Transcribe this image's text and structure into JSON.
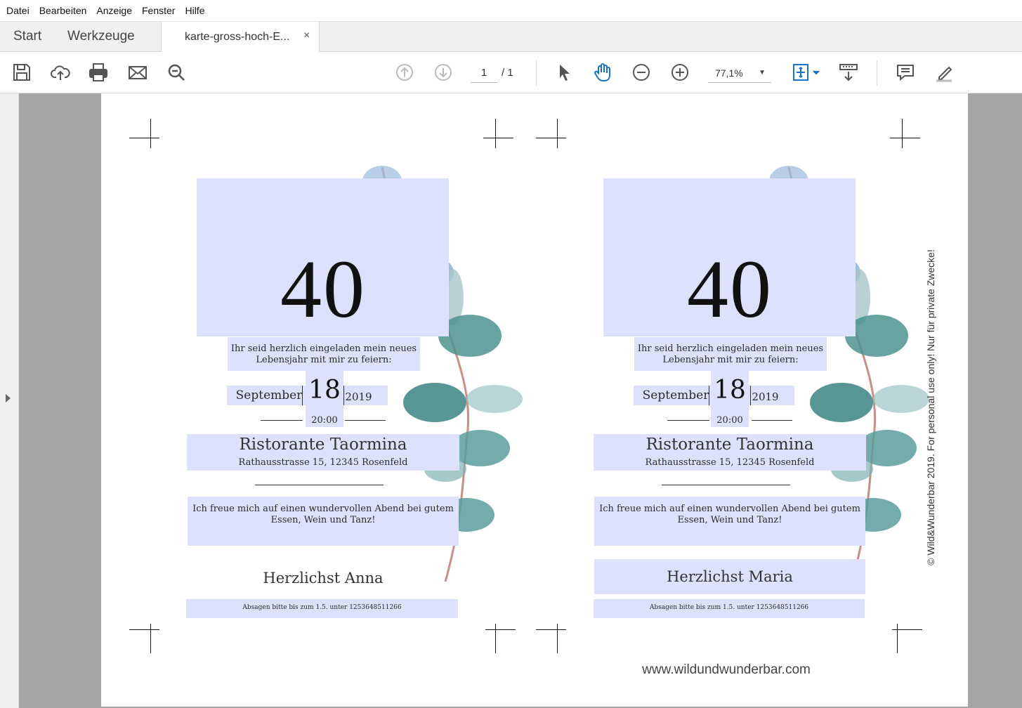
{
  "menu": [
    "Datei",
    "Bearbeiten",
    "Anzeige",
    "Fenster",
    "Hilfe"
  ],
  "tabs": {
    "start": "Start",
    "tools": "Werkzeuge",
    "document": "karte-gross-hoch-E...",
    "close": "×"
  },
  "toolbar": {
    "page_current": "1",
    "page_total": "/ 1",
    "zoom": "77,1%",
    "icons": [
      "save-icon",
      "cloud-upload-icon",
      "print-icon",
      "mail-icon",
      "search-zoom-icon",
      "prev-page-icon",
      "next-page-icon",
      "select-arrow-icon",
      "hand-icon",
      "zoom-out-icon",
      "zoom-in-icon",
      "fit-page-icon",
      "scroll-mode-icon",
      "comment-icon",
      "highlight-pen-icon"
    ]
  },
  "cards": [
    {
      "number": "40",
      "invite": [
        "Ihr seid herzlich eingeladen mein neues",
        "Lebensjahr mit mir zu feiern:"
      ],
      "month": "September",
      "day": "18",
      "year": "2019",
      "time": "20:00",
      "venue": "Ristorante Taormina",
      "address": "Rathausstrasse 15, 12345 Rosenfeld",
      "message": [
        "Ich freue mich auf einen wundervollen Abend bei gutem",
        "Essen, Wein und Tanz!"
      ],
      "signature": "Herzlichst Anna",
      "rsvp": "Absagen bitte bis zum 1.5. unter 1253648511266"
    },
    {
      "number": "40",
      "invite": [
        "Ihr seid herzlich eingeladen mein neues",
        "Lebensjahr mit mir zu feiern:"
      ],
      "month": "September",
      "day": "18",
      "year": "2019",
      "time": "20:00",
      "venue": "Ristorante Taormina",
      "address": "Rathausstrasse 15, 12345 Rosenfeld",
      "message": [
        "Ich freue mich auf einen wundervollen Abend bei gutem",
        "Essen, Wein und Tanz!"
      ],
      "signature": "Herzlichst Maria",
      "rsvp": "Absagen bitte bis zum 1.5. unter 1253648511266"
    }
  ],
  "copyright": "© Wild&Wunderbar 2019. For personal use only! Nur für private Zwecke!",
  "website": "www.wildundwunderbar.com",
  "colors": {
    "highlight": "#dde1fc",
    "leaf_blue": "#8fb0d8",
    "leaf_teal": "#4e938f",
    "stem": "#c98f86"
  }
}
